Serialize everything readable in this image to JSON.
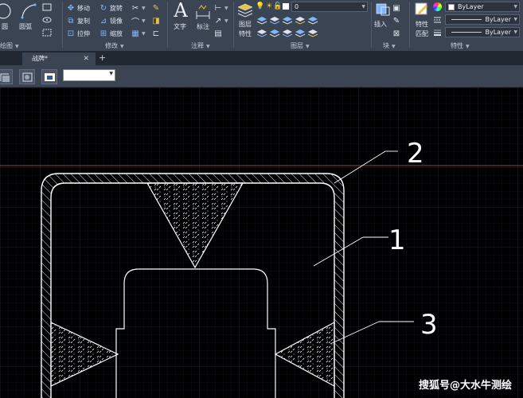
{
  "ribbon": {
    "draw_panel": {
      "circle_label": "圆",
      "arc_label": "圆弧",
      "panel_label": "绘图"
    },
    "modify_panel": {
      "move": "移动",
      "rotate": "旋转",
      "copy": "复制",
      "mirror": "镜像",
      "stretch": "拉伸",
      "scale": "缩放",
      "panel_label": "修改"
    },
    "annotation_panel": {
      "text": "文字",
      "dimension": "标注",
      "panel_label": "注释"
    },
    "layers_panel": {
      "layer_properties_line1": "图层",
      "layer_properties_line2": "特性",
      "current_layer": "0",
      "panel_label": "图层"
    },
    "block_panel": {
      "insert": "插入",
      "panel_label": "块"
    },
    "properties_panel": {
      "match_line1": "特性",
      "match_line2": "匹配",
      "color_value": "ByLayer",
      "linetype_value": "ByLayer",
      "lineweight_value": "ByLayer",
      "panel_label": "特性"
    },
    "colors": {
      "ribbon_bg": "#3b4453",
      "accent_blue": "#7fb7ff"
    }
  },
  "tabs": {
    "active_label": "战牌*",
    "close_glyph": "✕",
    "add_glyph": "+"
  },
  "canvas": {
    "callouts": [
      "2",
      "1",
      "3"
    ],
    "line_color": "#ffffff",
    "grid_color": "#1c2230",
    "crosshair_color": "#c06030",
    "hatch": "ANSI31 diagonal + dotted fill"
  },
  "watermark": "搜狐号@大水牛测绘"
}
